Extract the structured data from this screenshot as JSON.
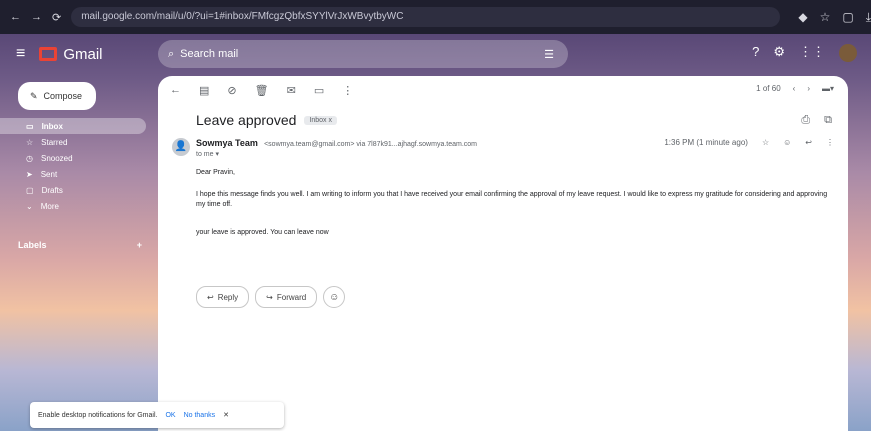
{
  "browser": {
    "url": "mail.google.com/mail/u/0/?ui=1#inbox/FMfcgzQbfxSYYlVrJxWBvytbyWC"
  },
  "gmail": {
    "app_name": "Gmail",
    "search_placeholder": "Search mail"
  },
  "sidebar": {
    "compose_label": "Compose",
    "items": [
      {
        "label": "Inbox"
      },
      {
        "label": "Starred"
      },
      {
        "label": "Snoozed"
      },
      {
        "label": "Sent"
      },
      {
        "label": "Drafts"
      },
      {
        "label": "More"
      }
    ],
    "labels_heading": "Labels"
  },
  "toolbar": {
    "pager_text": "1 of 60"
  },
  "email": {
    "subject": "Leave approved",
    "chip": "Inbox x",
    "sender_name": "Sowmya Team",
    "sender_email": "<sowmya.team@gmail.com> via 7l87k91...ajhagf.sowmya.team.com",
    "to_me": "to me",
    "time": "1:36 PM (1 minute ago)",
    "greeting": "Dear Pravin,",
    "para1": "I hope this message finds you well. I am writing to inform you that I have received your email confirming the approval of my leave request. I would like to express my gratitude for considering and approving my time off.",
    "para2": "your leave is approved. You can leave now",
    "reply": "Reply",
    "forward": "Forward"
  },
  "notification": {
    "text": "Enable desktop notifications for Gmail.",
    "ok": "OK",
    "no_thanks": "No thanks"
  }
}
